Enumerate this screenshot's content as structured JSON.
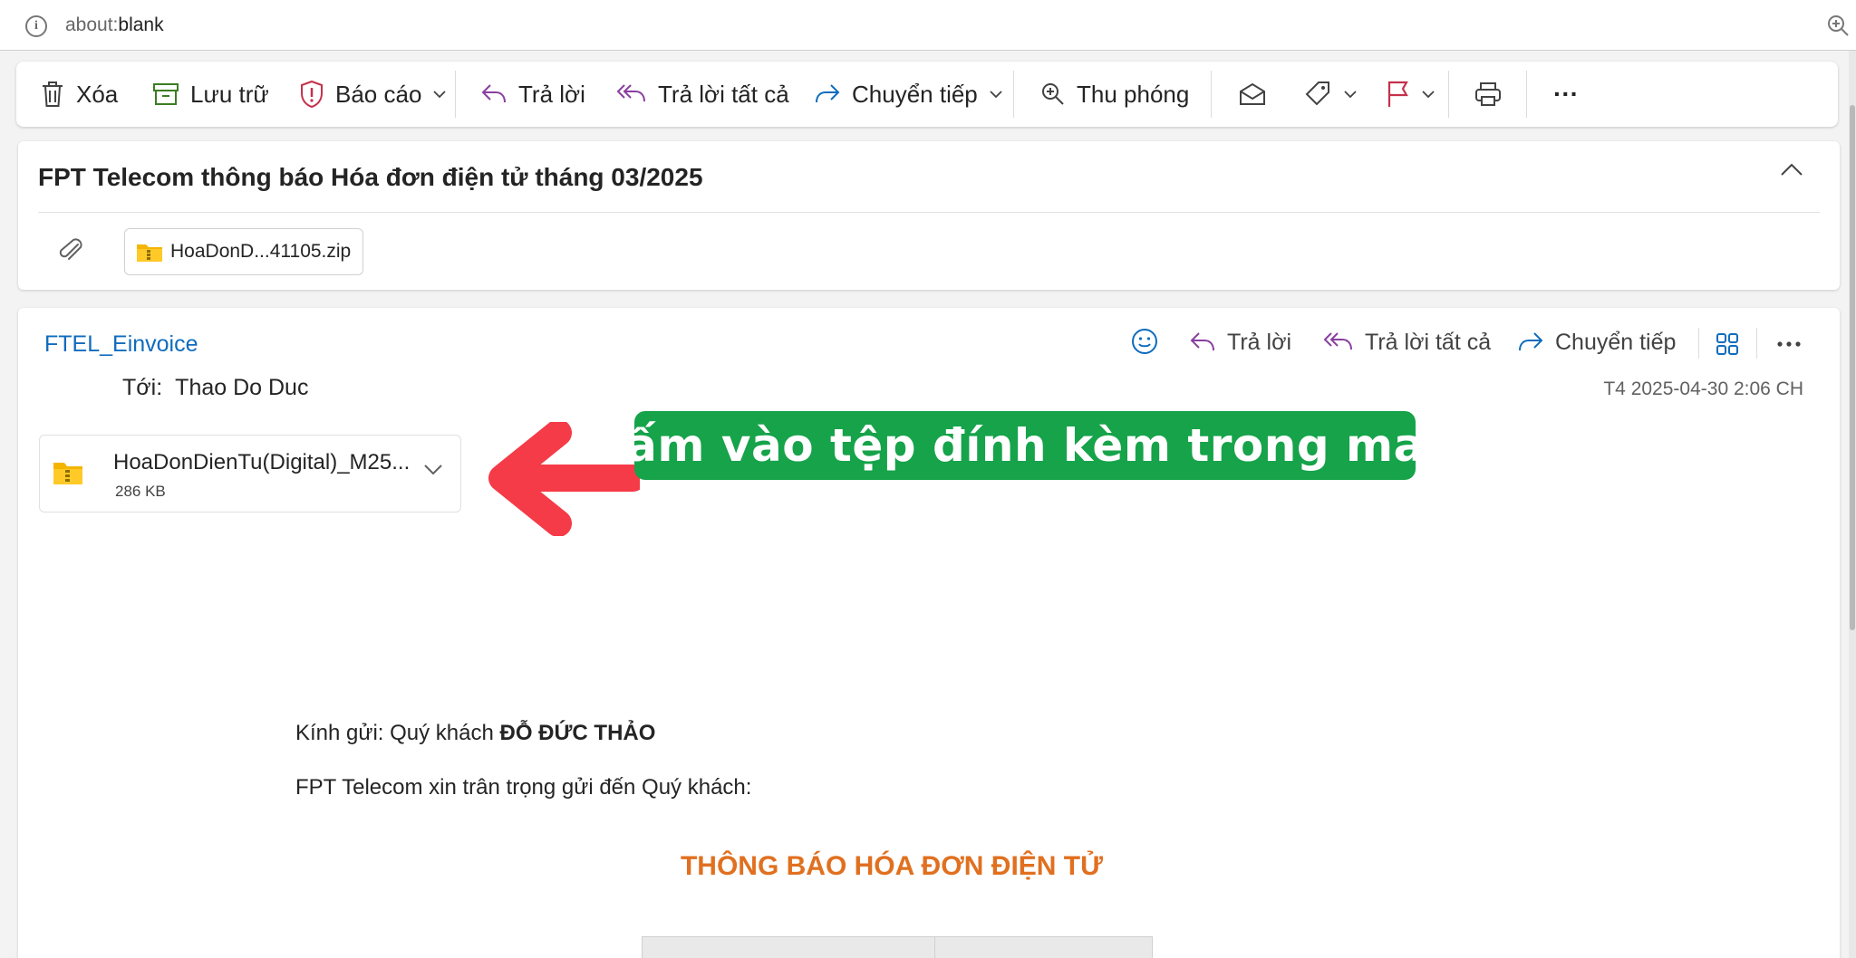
{
  "browser": {
    "url_scheme": "about:",
    "url_path": "blank",
    "info_icon": "info-icon",
    "zoom_icon": "zoom-in-icon"
  },
  "toolbar": {
    "delete": "Xóa",
    "archive": "Lưu trữ",
    "report": "Báo cáo",
    "reply": "Trả lời",
    "reply_all": "Trả lời tất cả",
    "forward": "Chuyển tiếp",
    "zoom": "Thu phóng",
    "more": "···"
  },
  "subject": {
    "title": "FPT Telecom thông báo Hóa đơn điện tử tháng 03/2025",
    "attachment_chip": "HoaDonD...41105.zip"
  },
  "message": {
    "sender": "FTEL_Einvoice",
    "reply": "Trả lời",
    "reply_all": "Trả lời tất cả",
    "forward": "Chuyển tiếp",
    "to_label": "Tới:",
    "to_value": "Thao Do Duc",
    "date": "T4 2025-04-30 2:06 CH",
    "attachment_name": "HoaDonDienTu(Digital)_M25...",
    "attachment_size": "286 KB"
  },
  "annotation": {
    "callout": "bấm vào tệp đính kèm trong mail",
    "color": "#16a34a",
    "arrow_color": "#f43b47"
  },
  "body": {
    "greeting_prefix": "Kính gửi: Quý khách ",
    "customer_name": "ĐỖ ĐỨC THẢO",
    "intro": "FPT Telecom xin trân trọng gửi đến Quý khách:",
    "heading": "THÔNG BÁO HÓA ĐƠN ĐIỆN TỬ"
  },
  "colors": {
    "link": "#0f6cbd",
    "heading_orange": "#e07020",
    "reply_purple": "#8a3ea0",
    "forward_blue": "#0f6cbd",
    "archive_green": "#3b7d23",
    "report_red": "#c4314b",
    "flag_red": "#c4314b"
  }
}
